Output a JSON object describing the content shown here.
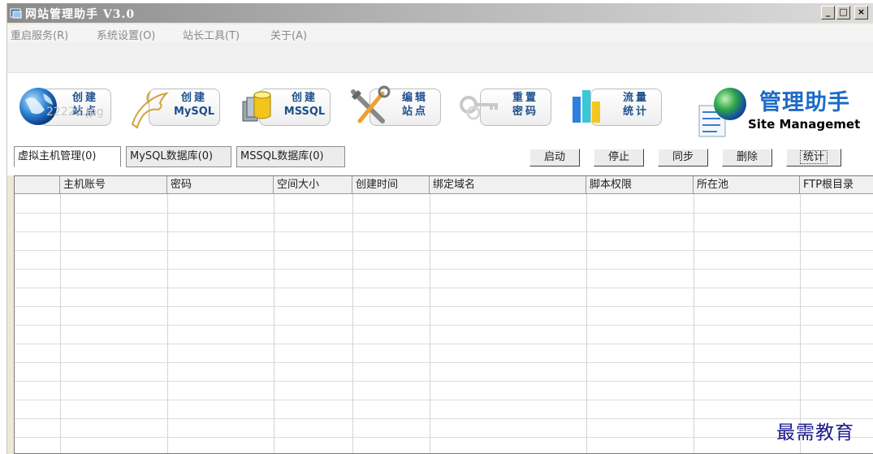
{
  "window": {
    "title": "网站管理助手 V3.0",
    "controls": [
      "_",
      "□",
      "×"
    ]
  },
  "menu": [
    {
      "label": "重启服务(R)"
    },
    {
      "label": "系统设置(O)"
    },
    {
      "label": "站长工具(T)"
    },
    {
      "label": "关于(A)"
    }
  ],
  "toolbar": {
    "ghost_text": "22222.jpg",
    "buttons": [
      {
        "line1": "创建",
        "line2": "站点",
        "icon": "globe-icon"
      },
      {
        "line1": "创建",
        "line2": "MySQL",
        "icon": "dolphin-icon"
      },
      {
        "line1": "创建",
        "line2": "MSSQL",
        "icon": "database-icon"
      },
      {
        "line1": "编辑",
        "line2": "站点",
        "icon": "tools-icon"
      },
      {
        "line1": "重置",
        "line2": "密码",
        "icon": "keys-icon"
      },
      {
        "line1": "流量",
        "line2": "统计",
        "icon": "bar-chart-icon"
      }
    ]
  },
  "logo": {
    "cn": "管理助手",
    "en": "Site Managemet"
  },
  "tabs": [
    {
      "label": "虚拟主机管理(0)",
      "active": true
    },
    {
      "label": "MySQL数据库(0)",
      "active": false
    },
    {
      "label": "MSSQL数据库(0)",
      "active": false
    }
  ],
  "actions": [
    {
      "label": "启动"
    },
    {
      "label": "停止"
    },
    {
      "label": "同步"
    },
    {
      "label": "删除"
    },
    {
      "label": "统计"
    }
  ],
  "table": {
    "columns": [
      "",
      "主机账号",
      "密码",
      "空间大小",
      "创建时间",
      "绑定域名",
      "脚本权限",
      "所在池",
      "FTP根目录"
    ],
    "rows": []
  },
  "watermark": "最需教育"
}
